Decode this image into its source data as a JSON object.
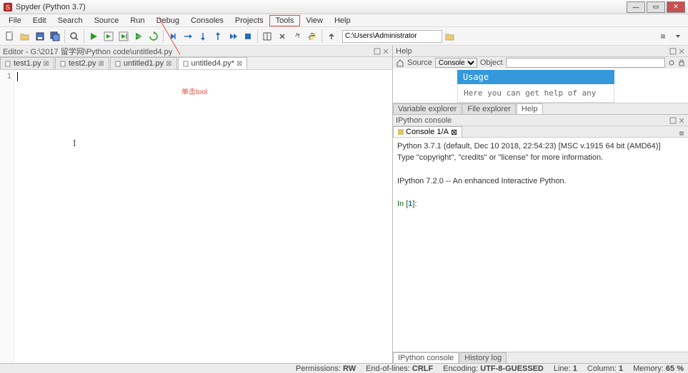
{
  "title": "Spyder (Python 3.7)",
  "menu": [
    "File",
    "Edit",
    "Search",
    "Source",
    "Run",
    "Debug",
    "Consoles",
    "Projects",
    "Tools",
    "View",
    "Help"
  ],
  "menu_highlight_index": 8,
  "breadcrumb_path": "C:\\Users\\Administrator",
  "editor": {
    "header": "Editor - G:\\2017 留学网\\Python code\\untitled4.py",
    "tabs": [
      {
        "label": "test1.py",
        "active": false
      },
      {
        "label": "test2.py",
        "active": false
      },
      {
        "label": "untitled1.py",
        "active": false
      },
      {
        "label": "untitled4.py*",
        "active": true
      }
    ],
    "line_number": "1",
    "annotation": "单击tool"
  },
  "help": {
    "header": "Help",
    "source_label": "Source",
    "source_value": "Console",
    "object_label": "Object",
    "usage_title": "Usage",
    "usage_body": "Here you can get help of any",
    "tabs": [
      "Variable explorer",
      "File explorer",
      "Help"
    ],
    "active_tab": 2
  },
  "console": {
    "header": "IPython console",
    "tab_label": "Console 1/A",
    "banner_line1": "Python 3.7.1 (default, Dec 10 2018, 22:54:23) [MSC v.1915 64 bit (AMD64)]",
    "banner_line2": "Type \"copyright\", \"credits\" or \"license\" for more information.",
    "banner_line3": "IPython 7.2.0 -- An enhanced Interactive Python.",
    "prompt": "In [1]:",
    "bottom_tabs": [
      "IPython console",
      "History log"
    ]
  },
  "status": {
    "permissions_label": "Permissions:",
    "permissions_value": "RW",
    "eol_label": "End-of-lines:",
    "eol_value": "CRLF",
    "encoding_label": "Encoding:",
    "encoding_value": "UTF-8-GUESSED",
    "line_label": "Line:",
    "line_value": "1",
    "column_label": "Column:",
    "column_value": "1",
    "memory_label": "Memory:",
    "memory_value": "65 %"
  }
}
